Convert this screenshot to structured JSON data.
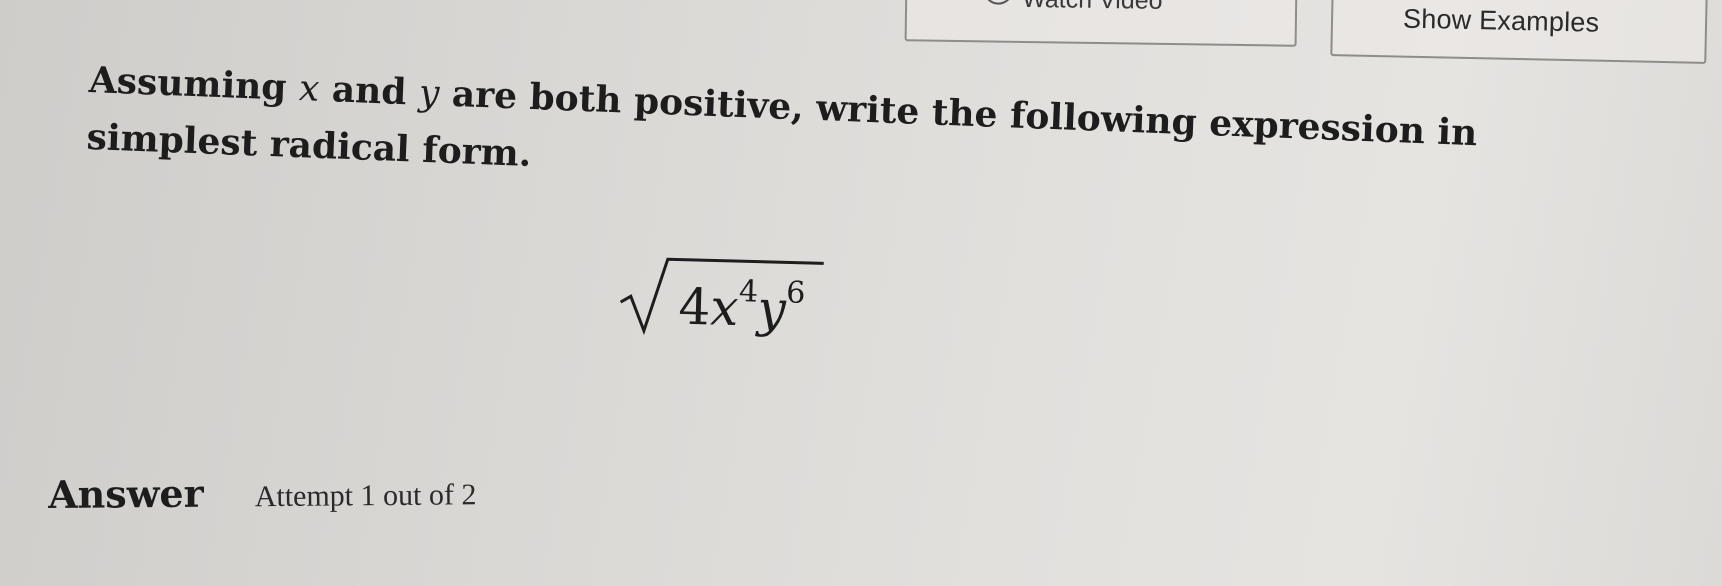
{
  "toolbar": {
    "watch_video_label": "Watch Video",
    "show_examples_label": "Show Examples"
  },
  "question": {
    "part1": "Assuming",
    "var_x": "x",
    "part2": "and",
    "var_y": "y",
    "part3": "are both positive, write the following expression in simplest radical form."
  },
  "expression": {
    "coefficient": "4",
    "var1": "x",
    "exp1": "4",
    "var2": "y",
    "exp2": "6"
  },
  "answer": {
    "label": "Answer",
    "attempt": "Attempt 1 out of 2"
  },
  "icons": {
    "video": "play-circle-icon",
    "radical": "square-root-icon"
  }
}
